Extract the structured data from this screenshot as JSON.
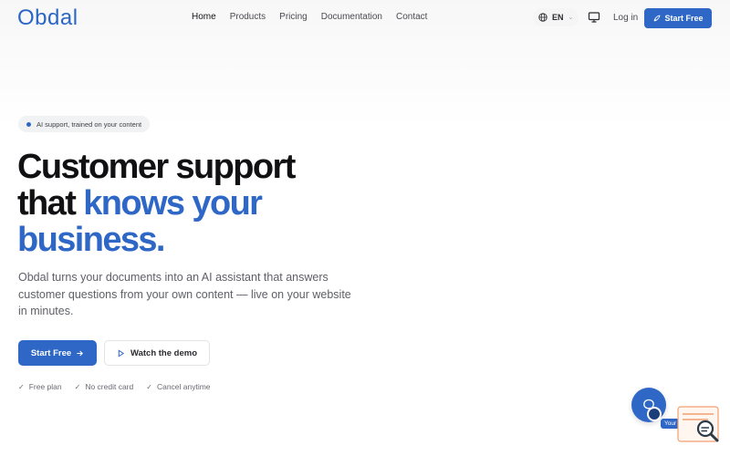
{
  "header": {
    "logo": "Obdal",
    "nav": [
      "Home",
      "Products",
      "Pricing",
      "Documentation",
      "Contact"
    ],
    "active_nav": "Home",
    "language": "EN",
    "login": "Log in",
    "cta": "Start Free"
  },
  "hero": {
    "badge": "AI support, trained on your content",
    "headline_line1": "Customer support",
    "headline_line2_plain": "that ",
    "headline_line2_blue": "knows your",
    "headline_line3_blue": "business.",
    "subtitle": "Obdal turns your documents into an AI assistant that answers customer questions from your own content — live on your website in minutes.",
    "primary_button": "Start Free",
    "secondary_button": "Watch the demo",
    "perks": [
      "Free plan",
      "No credit card",
      "Cancel anytime"
    ]
  },
  "chat_widget": {
    "label": "Your ..."
  },
  "colors": {
    "brand": "#2e67c6",
    "text_dark": "#111114",
    "muted": "#5f6068"
  },
  "icons": {
    "globe": "globe-icon",
    "chevron": "chevron-down-icon",
    "monitor": "monitor-icon",
    "rocket": "rocket-icon",
    "arrow": "arrow-right-icon",
    "play": "play-icon",
    "check": "check-icon",
    "chat": "chat-bubble-icon",
    "search": "search-icon"
  }
}
